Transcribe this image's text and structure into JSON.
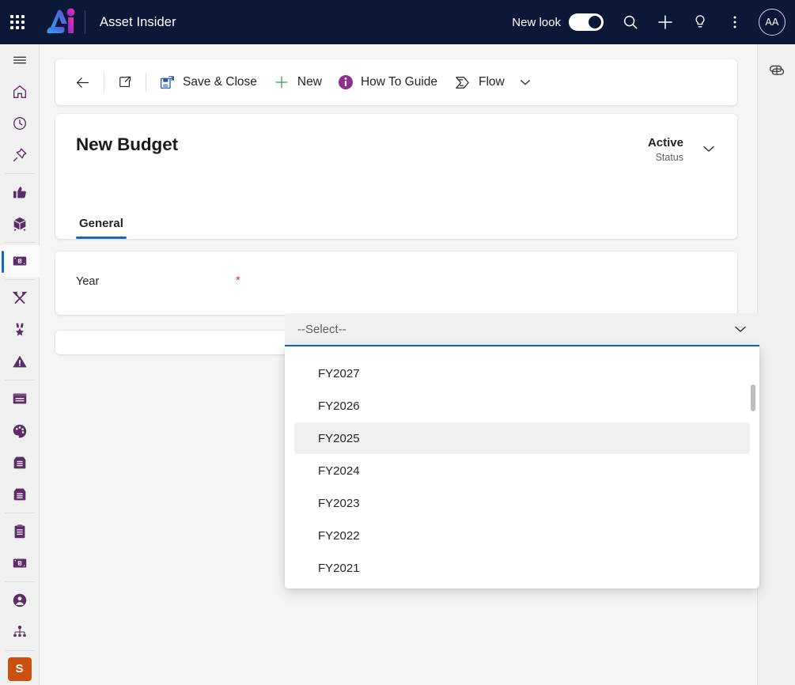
{
  "topnav": {
    "waffle_icon": "app-launcher-icon",
    "app_title": "Asset Insider",
    "new_look_label": "New look",
    "toggle_state": "on",
    "search_icon": "search-icon",
    "add_icon": "plus-icon",
    "ideas_icon": "lightbulb-icon",
    "more_icon": "more-vertical-icon",
    "avatar_initials": "AA",
    "background_color": "#0c1838"
  },
  "leftrail": {
    "items": [
      {
        "name": "hamburger",
        "icon": "hamburger-menu-icon"
      },
      {
        "name": "home",
        "icon": "home-icon"
      },
      {
        "name": "recent",
        "icon": "clock-recent-icon"
      },
      {
        "name": "pinned",
        "icon": "pin-icon"
      },
      {
        "name": "approvals",
        "icon": "thumbs-up-icon"
      },
      {
        "name": "assets",
        "icon": "cube-box-icon"
      },
      {
        "name": "budgets",
        "icon": "money-card-icon",
        "selected": true
      },
      {
        "name": "maintenance",
        "icon": "tools-icon"
      },
      {
        "name": "awards",
        "icon": "medal-icon"
      },
      {
        "name": "alerts",
        "icon": "warning-triangle-icon"
      },
      {
        "name": "records",
        "icon": "window-list-icon"
      },
      {
        "name": "themes",
        "icon": "palette-icon"
      },
      {
        "name": "inbound",
        "icon": "archive-in-icon"
      },
      {
        "name": "outbound",
        "icon": "archive-out-icon"
      },
      {
        "name": "tasks",
        "icon": "clipboard-icon"
      },
      {
        "name": "expenses",
        "icon": "money-card-icon"
      },
      {
        "name": "contacts",
        "icon": "person-circle-icon"
      },
      {
        "name": "hierarchy",
        "icon": "org-chart-icon"
      }
    ],
    "badge": {
      "label": "S",
      "color": "#ca5010"
    },
    "selection_color": "#0f6cbd",
    "icon_color": "#5c2d68"
  },
  "rightrail": {
    "copilot_icon": "copilot-icon"
  },
  "commandbar": {
    "back_icon": "arrow-left-icon",
    "popout_icon": "open-in-new-window-icon",
    "items": [
      {
        "label": "Save & Close",
        "icon": "save-and-close-icon"
      },
      {
        "label": "New",
        "icon": "plus-icon"
      },
      {
        "label": "How To Guide",
        "icon": "info-circle-icon"
      },
      {
        "label": "Flow",
        "icon": "power-automate-flow-icon"
      }
    ],
    "overflow_icon": "chevron-down-icon"
  },
  "form": {
    "record_title": "New Budget",
    "status_value": "Active",
    "status_label": "Status",
    "status_chevron_icon": "chevron-down-icon",
    "tabs": [
      {
        "label": "General",
        "active": true
      }
    ],
    "field": {
      "label": "Year",
      "required_marker": "*",
      "required_color": "#c4314b"
    }
  },
  "combobox": {
    "placeholder": "--Select--",
    "value": "",
    "chevron_icon": "chevron-down-icon",
    "expanded": true,
    "underline_color": "#0f6cbd",
    "options": [
      {
        "label": "FY2027",
        "hovered": false
      },
      {
        "label": "FY2026",
        "hovered": false
      },
      {
        "label": "FY2025",
        "hovered": true
      },
      {
        "label": "FY2024",
        "hovered": false
      },
      {
        "label": "FY2023",
        "hovered": false
      },
      {
        "label": "FY2022",
        "hovered": false
      },
      {
        "label": "FY2021",
        "hovered": false
      }
    ],
    "scrollbar_icon": "vertical-scrollbar-thumb"
  }
}
